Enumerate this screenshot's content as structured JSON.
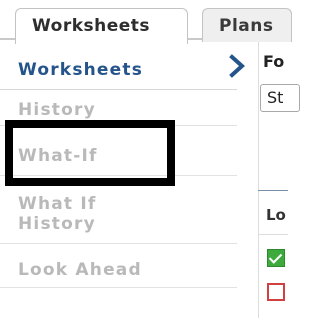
{
  "tabs": [
    {
      "label": "Worksheets",
      "active": true
    },
    {
      "label": "Plans",
      "active": false
    }
  ],
  "sidebar": {
    "items": [
      {
        "lines": [
          "Worksheets"
        ],
        "active": true
      },
      {
        "lines": [
          "History"
        ],
        "active": false
      },
      {
        "lines": [
          "What-If"
        ],
        "active": false
      },
      {
        "lines": [
          "What If",
          "History"
        ],
        "active": false
      },
      {
        "lines": [
          "Look Ahead"
        ],
        "active": false
      }
    ]
  },
  "right_panel": {
    "label_top": "Fo",
    "select_value": "St",
    "column_header": "Lo"
  },
  "colors": {
    "active_nav": "#25548b",
    "inactive_nav": "#b9b9b9",
    "highlight_box": "#000000",
    "checkbox_checked": "#3eaa3e",
    "checkbox_unchecked_border": "#d04040"
  }
}
